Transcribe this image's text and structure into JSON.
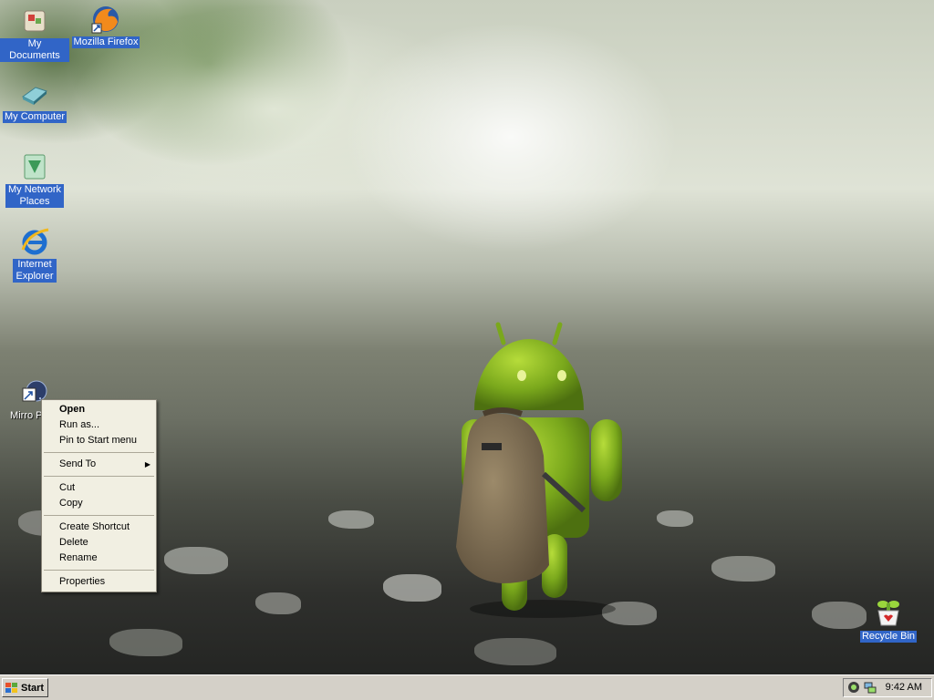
{
  "desktop": {
    "icons": [
      {
        "label": "My Documents",
        "icon": "my-documents-icon"
      },
      {
        "label": "Mozilla Firefox",
        "icon": "firefox-icon"
      },
      {
        "label": "My Computer",
        "icon": "my-computer-icon"
      },
      {
        "label": "My Network Places",
        "icon": "network-places-icon"
      },
      {
        "label": "Internet Explorer",
        "icon": "internet-explorer-icon"
      },
      {
        "label": "Mirro Pl",
        "icon": "mirro-player-icon"
      },
      {
        "label": "Recycle Bin",
        "icon": "recycle-bin-icon"
      }
    ]
  },
  "context_menu": {
    "items": [
      {
        "label": "Open"
      },
      {
        "label": "Run as..."
      },
      {
        "label": "Pin to Start menu"
      },
      {
        "label": "Send To"
      },
      {
        "label": "Cut"
      },
      {
        "label": "Copy"
      },
      {
        "label": "Create Shortcut"
      },
      {
        "label": "Delete"
      },
      {
        "label": "Rename"
      },
      {
        "label": "Properties"
      }
    ],
    "submenu_arrow": "▶"
  },
  "taskbar": {
    "start_label": "Start",
    "clock": "9:42 AM",
    "tray_icons": [
      "volume-icon",
      "network-icon"
    ]
  },
  "colors": {
    "selection": "#3165c7",
    "menu_bg": "#f1efe2",
    "taskbar_bg": "#d4d0c8"
  }
}
